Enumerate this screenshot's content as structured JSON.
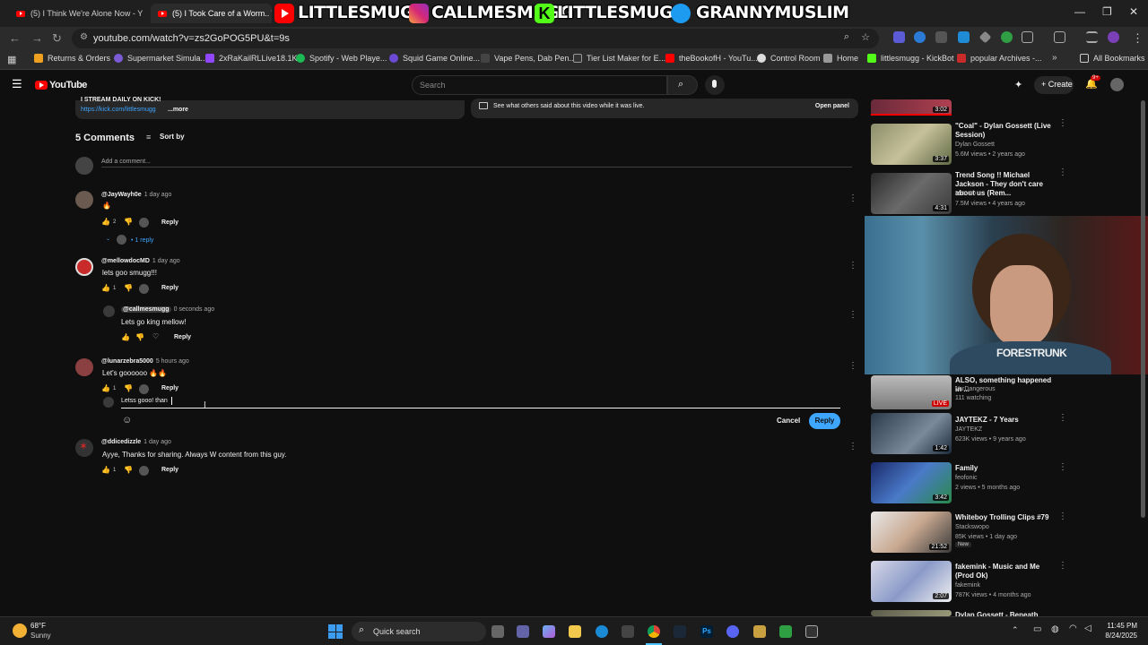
{
  "browser": {
    "tabs": [
      {
        "label": "(5) I Think We're Alone Now - Y"
      },
      {
        "label": "(5) I Took Care of a Worm.. The"
      }
    ],
    "overlay": {
      "youtube_handle": "LITTLESMUGG",
      "instagram_handle": "CALLMESMUGG",
      "kick_handle": "LITTLESMUGG",
      "twitter_handle": "GRANNYMUSLIM"
    },
    "url": "youtube.com/watch?v=zs2GoPOG5PU&t=9s",
    "bookmarks": [
      "Returns & Orders",
      "Supermarket Simula...",
      "2xRaKailRLLive18.1K...",
      "Spotify - Web Playe...",
      "Squid Game Online...",
      "Vape Pens, Dab Pen...",
      "Tier List Maker for E...",
      "theBookofH - YouTu...",
      "Control Room",
      "Home",
      "littlesmugg - KickBot",
      "popular Archives -...",
      "All Bookmarks"
    ]
  },
  "youtube": {
    "logo": "YouTube",
    "search_placeholder": "Search",
    "create_label": "Create",
    "notif_count": "9+"
  },
  "description": {
    "line1": "I STREAM DAILY ON KICK!",
    "link": "https://kick.com/littlesmugg",
    "more": "...more"
  },
  "live_chat": {
    "text": "See what others said about this video while it was live.",
    "button": "Open panel"
  },
  "comments": {
    "count_label": "5 Comments",
    "sort_label": "Sort by",
    "add_placeholder": "Add a comment...",
    "items": [
      {
        "user": "@JayWayh0e",
        "time": "1 day ago",
        "text": "🔥",
        "likes": "2",
        "replies": "1 reply"
      },
      {
        "user": "@mellowdocMD",
        "time": "1 day ago",
        "text": "lets goo smugg!!!",
        "likes": "1"
      },
      {
        "user": "@callmesmugg",
        "time": "0 seconds ago",
        "text": "Lets go king mellow!"
      },
      {
        "user": "@lunarzebra5000",
        "time": "5 hours ago",
        "text": "Let's goooooo 🔥🔥",
        "likes": "1"
      },
      {
        "user": "@ddicedizzle",
        "time": "1 day ago",
        "text": "Ayye, Thanks for sharing. Always W content from this guy.",
        "likes": "1"
      }
    ],
    "reply_label": "Reply",
    "draft_text": "Letss gooo! than",
    "cancel_label": "Cancel",
    "reply_button": "Reply"
  },
  "sidebar": {
    "videos": [
      {
        "title": "",
        "channel": "",
        "meta": "",
        "duration": "3:02"
      },
      {
        "title": "\"Coal\" - Dylan Gossett (Live Session)",
        "channel": "Dylan Gossett",
        "meta": "5.6M views • 2 years ago",
        "duration": "3:37"
      },
      {
        "title": "Trend Song !! Michael Jackson - They don't care about us (Rem...",
        "channel": "MrX-80",
        "meta": "7.5M views • 4 years ago",
        "duration": "4:31"
      },
      {
        "title": "ALSO, something happened in ...",
        "channel": "VarDangerous",
        "meta": "111 watching",
        "duration": "LIVE"
      },
      {
        "title": "JAYTEKZ - 7 Years",
        "channel": "JAYTEKZ",
        "meta": "623K views • 9 years ago",
        "duration": "1:42"
      },
      {
        "title": "Family",
        "channel": "feofonic",
        "meta": "2 views • 5 months ago",
        "duration": "3:42"
      },
      {
        "title": "Whiteboy Trolling Clips #79",
        "channel": "Stackswopo",
        "meta": "85K views • 1 day ago",
        "duration": "21:52",
        "badge": "New"
      },
      {
        "title": "fakemink - Music and Me (Prod Ok)",
        "channel": "fakemink",
        "meta": "787K views • 4 months ago",
        "duration": "2:07"
      },
      {
        "title": "Dylan Gossett - Beneath Oak",
        "channel": "",
        "meta": "",
        "duration": ""
      }
    ],
    "webcam_shirt": "FORESTRUNK"
  },
  "taskbar": {
    "weather_temp": "68°F",
    "weather_desc": "Sunny",
    "search_label": "Quick search",
    "time": "11:45 PM",
    "date": "8/24/2025"
  }
}
